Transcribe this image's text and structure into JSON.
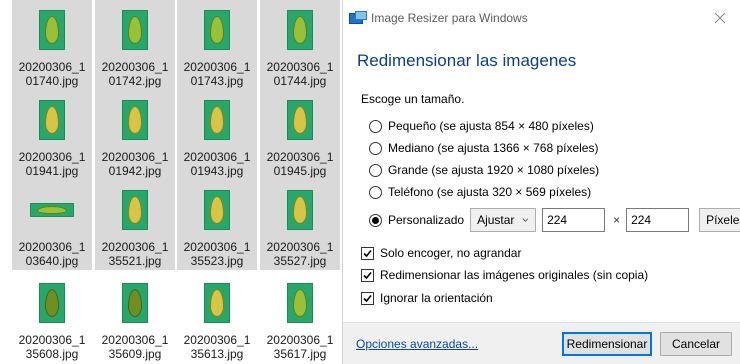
{
  "explorer": {
    "files": [
      {
        "name_line1": "20200306_1",
        "name_line2": "01740.jpg",
        "orientation": "portrait",
        "leaf": "green",
        "selected": true
      },
      {
        "name_line1": "20200306_1",
        "name_line2": "01742.jpg",
        "orientation": "portrait",
        "leaf": "green",
        "selected": true
      },
      {
        "name_line1": "20200306_1",
        "name_line2": "01743.jpg",
        "orientation": "portrait",
        "leaf": "green",
        "selected": true
      },
      {
        "name_line1": "20200306_1",
        "name_line2": "01744.jpg",
        "orientation": "portrait",
        "leaf": "green",
        "selected": true
      },
      {
        "name_line1": "20200306_1",
        "name_line2": "01941.jpg",
        "orientation": "portrait",
        "leaf": "yellow",
        "selected": true
      },
      {
        "name_line1": "20200306_1",
        "name_line2": "01942.jpg",
        "orientation": "portrait",
        "leaf": "yellow",
        "selected": true
      },
      {
        "name_line1": "20200306_1",
        "name_line2": "01943.jpg",
        "orientation": "portrait",
        "leaf": "yellow",
        "selected": true
      },
      {
        "name_line1": "20200306_1",
        "name_line2": "01945.jpg",
        "orientation": "portrait",
        "leaf": "yellow",
        "selected": true
      },
      {
        "name_line1": "20200306_1",
        "name_line2": "03640.jpg",
        "orientation": "landscape",
        "leaf": "green",
        "selected": true
      },
      {
        "name_line1": "20200306_1",
        "name_line2": "35521.jpg",
        "orientation": "portrait",
        "leaf": "yellow",
        "selected": true
      },
      {
        "name_line1": "20200306_1",
        "name_line2": "35523.jpg",
        "orientation": "portrait",
        "leaf": "yellow",
        "selected": true
      },
      {
        "name_line1": "20200306_1",
        "name_line2": "35527.jpg",
        "orientation": "portrait",
        "leaf": "yellow",
        "selected": true
      },
      {
        "name_line1": "20200306_1",
        "name_line2": "35608.jpg",
        "orientation": "portrait",
        "leaf": "dark",
        "selected": false
      },
      {
        "name_line1": "20200306_1",
        "name_line2": "35609.jpg",
        "orientation": "portrait",
        "leaf": "dark",
        "selected": false
      },
      {
        "name_line1": "20200306_1",
        "name_line2": "35613.jpg",
        "orientation": "portrait",
        "leaf": "yellow",
        "selected": false
      },
      {
        "name_line1": "20200306_1",
        "name_line2": "35617.jpg",
        "orientation": "portrait",
        "leaf": "green",
        "selected": false
      }
    ]
  },
  "dialog": {
    "title": "Image Resizer para Windows",
    "heading": "Redimensionar las imagenes",
    "prompt": "Escoge un tamaño.",
    "sizes": [
      {
        "label": "Pequeño (se ajusta 854 × 480 píxeles)",
        "checked": false
      },
      {
        "label": "Mediano (se ajusta 1366 × 768 píxeles)",
        "checked": false
      },
      {
        "label": "Grande (se ajusta 1920 × 1080 píxeles)",
        "checked": false
      },
      {
        "label": "Teléfono (se ajusta 320 × 569 píxeles)",
        "checked": false
      }
    ],
    "custom": {
      "label": "Personalizado",
      "checked": true,
      "fit_value": "Ajustar",
      "width": "224",
      "times": "×",
      "height": "224",
      "unit_value": "Píxeles"
    },
    "options": [
      {
        "label": "Solo encoger, no agrandar",
        "checked": true
      },
      {
        "label": "Redimensionar las imágenes originales (sin copia)",
        "checked": true
      },
      {
        "label": "Ignorar la orientación",
        "checked": true
      }
    ],
    "footer": {
      "advanced_link": "Opciones avanzadas...",
      "resize_button": "Redimensionar",
      "cancel_button": "Cancelar"
    },
    "colors": {
      "heading": "#0a3d8f",
      "link": "#0a47a8",
      "primary_border": "#0078d7",
      "selection": "#d9d9d9"
    }
  }
}
